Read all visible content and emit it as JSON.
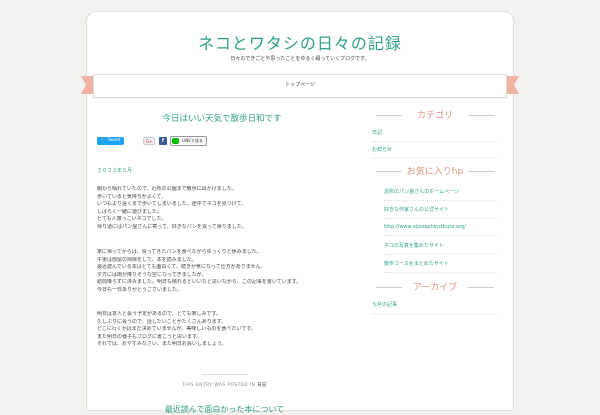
{
  "site": {
    "title": "ネコとワタシの日々の記録",
    "description": "日々のできごとや思ったことをゆるく綴っていくブログです。"
  },
  "nav": {
    "items": [
      "トップページ"
    ]
  },
  "post": {
    "title": "今日はいい天気で散歩日和です",
    "share": {
      "tweet_label": "Tweet",
      "google_label": "G+",
      "facebook_label": "f",
      "line_label": "LINEで送る"
    },
    "date": "２０２３年５月",
    "paragraphs": [
      [
        "朝から晴れていたので、近所の公園まで散歩に出かけました。",
        "歩いていると気持ちがよくて、",
        "いつもより遠くまで歩いてしまいました。途中でネコを見つけて、",
        "しばらく一緒に遊びました。",
        "とても人懐っこいネコでした。",
        "帰り道にはパン屋さんに寄って、好きなパンを買って帰りました。"
      ],
      [
        "家に帰ってからは、買ってきたパンを食べながらゆっくりと休みました。",
        "午後は部屋の掃除をして、本を読みました。",
        "最近読んでいる本はとても面白くて、続きが気になって仕方がありません。",
        "夕方には雨が降りそうな空になってきましたが、",
        "結局降らずに済みました。明日も晴れるといいなと思いながら、この記事を書いています。",
        "今日も一日ありがとうございました。"
      ],
      [
        "明日は友人と会う予定があるので、とても楽しみです。",
        "久しぶりに会うので、話したいことがたくさんあります。",
        "どこに行くかはまだ決めていませんが、美味しいものを食べたいです。",
        "また明日の様子もブログに書こうと思います。",
        "それでは、おやすみなさい。また明日お会いしましょう。"
      ]
    ],
    "meta_prefix": "THIS ENTRY WAS POSTED IN",
    "meta_category": "日記",
    "next_title": "最近読んで面白かった本について"
  },
  "sidebar": {
    "widgets": [
      {
        "title": "カテゴリ",
        "items": [
          "日記",
          "お知らせ"
        ],
        "indent": false
      },
      {
        "title": "お気に入りhp",
        "items": [
          "近所のパン屋さんのホームページ",
          "好きな作家さんの公式サイト",
          "http://www.stjosephinstitute.org/",
          "ネコの写真を集めたサイト",
          "散歩コースをまとめたサイト"
        ],
        "indent": true
      },
      {
        "title": "アーカイブ",
        "items": [
          "５月の記事"
        ],
        "indent": false
      }
    ]
  },
  "colors": {
    "accent": "#2e9f8a",
    "widget_title": "#e0937f",
    "ribbon": "#f0b2a3",
    "tweet": "#1da1f2",
    "facebook": "#3b5998",
    "line": "#00b900"
  }
}
